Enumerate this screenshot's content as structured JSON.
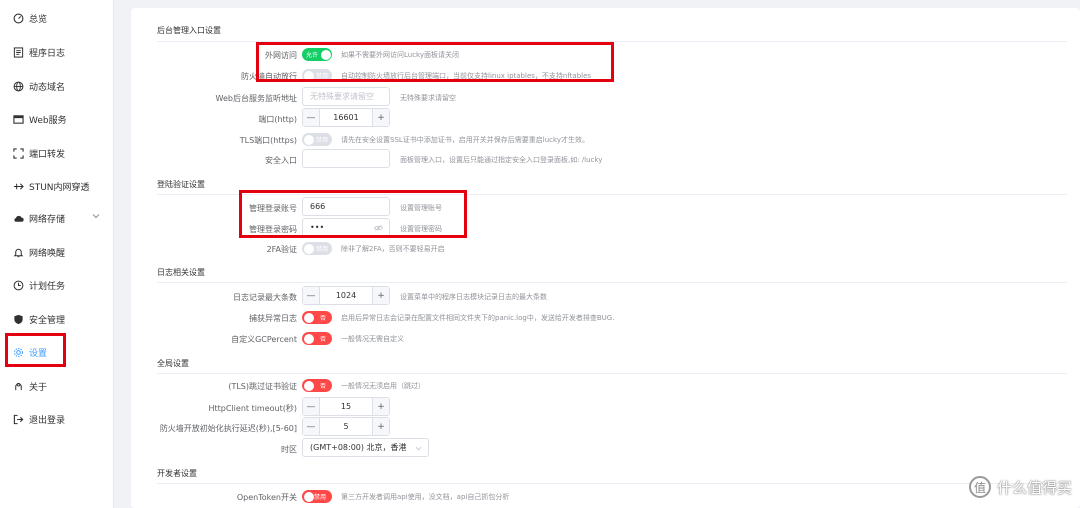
{
  "sidebar": {
    "items": [
      {
        "label": "总览",
        "icon": "dashboard-icon"
      },
      {
        "label": "程序日志",
        "icon": "log-icon"
      },
      {
        "label": "动态域名",
        "icon": "ddns-icon"
      },
      {
        "label": "Web服务",
        "icon": "web-icon"
      },
      {
        "label": "端口转发",
        "icon": "port-forward-icon"
      },
      {
        "label": "STUN内网穿透",
        "icon": "stun-icon"
      },
      {
        "label": "网络存储",
        "icon": "cloud-icon"
      },
      {
        "label": "网络唤醒",
        "icon": "bell-icon"
      },
      {
        "label": "计划任务",
        "icon": "clock-icon"
      },
      {
        "label": "安全管理",
        "icon": "shield-icon"
      },
      {
        "label": "设置",
        "icon": "gear-icon"
      },
      {
        "label": "关于",
        "icon": "about-icon"
      },
      {
        "label": "退出登录",
        "icon": "logout-icon"
      }
    ]
  },
  "sections": {
    "admin": "后台管理入口设置",
    "login": "登陆验证设置",
    "log": "日志相关设置",
    "global": "全局设置",
    "dev": "开发者设置"
  },
  "admin": {
    "wan_label": "外网访问",
    "wan_switch": "允许",
    "wan_hint": "如果不需要外网访问Lucky面板请关闭",
    "fw_label": "防火墙自动放行",
    "fw_switch": "禁用",
    "fw_hint": "自动控制防火墙放行后台管理端口，当前仅支持linux iptables，不支持nftables",
    "listen_label": "Web后台服务监听地址",
    "listen_placeholder": "无特殊要求请留空",
    "listen_hint": "无特殊要求请留空",
    "port_label": "端口(http)",
    "port_value": "16601",
    "tls_label": "TLS端口(https)",
    "tls_switch": "禁用",
    "tls_hint": "请先在安全设置SSL证书中添加证书，启用开关并保存后需要重启lucky才生效。",
    "safe_label": "安全入口",
    "safe_hint": "面板管理入口，设置后只能通过指定安全入口登录面板,如: /lucky"
  },
  "login": {
    "account_label": "管理登录账号",
    "account_value": "666",
    "account_hint": "设置管理账号",
    "password_label": "管理登录密码",
    "password_value": "•••",
    "password_hint": "设置管理密码",
    "twofa_label": "2FA验证",
    "twofa_switch": "禁用",
    "twofa_hint": "除非了解2FA，否则不要轻易开启"
  },
  "log": {
    "max_label": "日志记录最大条数",
    "max_value": "1024",
    "max_hint": "设置菜单中的程序日志模块记录日志的最大条数",
    "catch_label": "捕获异常日志",
    "catch_switch": "否",
    "catch_hint": "启用后异常日志会记录在配置文件相同文件夹下的panic.log中，发送给开发者排查BUG.",
    "gc_label": "自定义GCPercent",
    "gc_switch": "否",
    "gc_hint": "一般情况无需自定义"
  },
  "global": {
    "tls_skip_label": "(TLS)跳过证书验证",
    "tls_skip_switch": "否",
    "tls_skip_hint": "一般情况无须启用（跳过）",
    "timeout_label": "HttpClient timeout(秒)",
    "timeout_value": "15",
    "fw_delay_label": "防火墙开放初始化执行延迟(秒),[5-60]",
    "fw_delay_value": "5",
    "tz_label": "时区",
    "tz_value": "(GMT+08:00) 北京，香港"
  },
  "dev": {
    "token_label": "OpenToken开关",
    "token_switch": "禁用",
    "token_hint": "第三方开发者调用api使用，没文档，api自己抓包分析"
  },
  "watermark": {
    "badge": "值",
    "text": "什么值得买"
  }
}
